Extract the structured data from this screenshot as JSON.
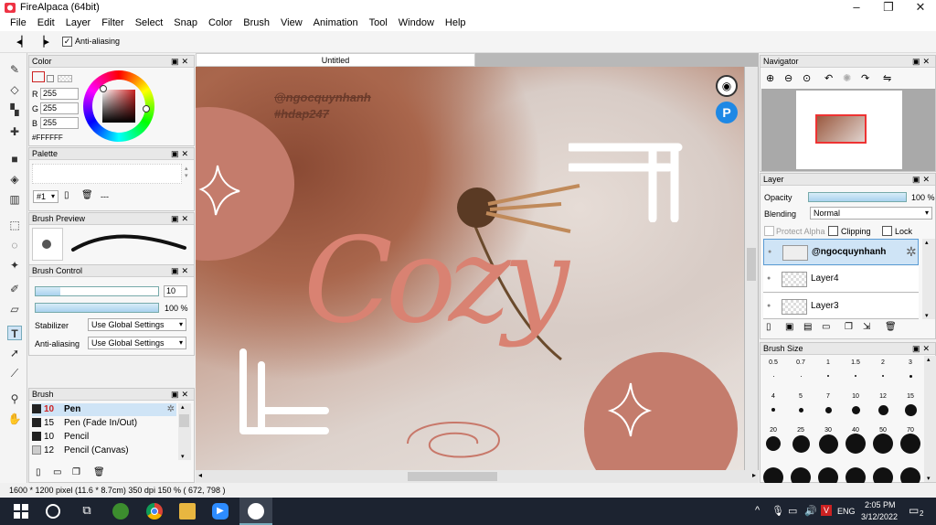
{
  "window": {
    "title": "FireAlpaca (64bit)",
    "minimize": "–",
    "maximize": "❐",
    "close": "✕"
  },
  "menu": [
    "File",
    "Edit",
    "Layer",
    "Filter",
    "Select",
    "Snap",
    "Color",
    "Brush",
    "View",
    "Animation",
    "Tool",
    "Window",
    "Help"
  ],
  "options": {
    "antialias_label": "Anti-aliasing"
  },
  "color_panel": {
    "title": "Color",
    "r_label": "R",
    "g_label": "G",
    "b_label": "B",
    "r": "255",
    "g": "255",
    "b": "255",
    "hex": "#FFFFFF"
  },
  "palette_panel": {
    "title": "Palette",
    "selector": "#1",
    "extra": "---"
  },
  "brush_preview_panel": {
    "title": "Brush Preview"
  },
  "brush_control": {
    "title": "Brush Control",
    "size": "10",
    "opacity": "100 %",
    "stabilizer_label": "Stabilizer",
    "stabilizer_value": "Use Global Settings",
    "antialias_label": "Anti-aliasing",
    "antialias_value": "Use Global Settings"
  },
  "brush_panel": {
    "title": "Brush",
    "items": [
      {
        "size": "10",
        "name": "Pen",
        "color": "#222222",
        "selected": true
      },
      {
        "size": "15",
        "name": "Pen (Fade In/Out)",
        "color": "#222222"
      },
      {
        "size": "10",
        "name": "Pencil",
        "color": "#222222"
      },
      {
        "size": "12",
        "name": "Pencil (Canvas)",
        "color": "#cccccc"
      }
    ]
  },
  "document": {
    "tab": "Untitled"
  },
  "artwork": {
    "watermark_1": "@ngocquynhanh",
    "watermark_2": "#hdap247",
    "word": "Cozy"
  },
  "navigator": {
    "title": "Navigator"
  },
  "layer_panel": {
    "title": "Layer",
    "opacity_label": "Opacity",
    "opacity_value": "100 %",
    "blending_label": "Blending",
    "blending_value": "Normal",
    "protect_alpha": "Protect Alpha",
    "clipping": "Clipping",
    "lock": "Lock",
    "layers": [
      {
        "name": "@ngocquynhanh",
        "selected": true
      },
      {
        "name": "Layer4"
      },
      {
        "name": "Layer3"
      }
    ]
  },
  "brush_size_panel": {
    "title": "Brush Size",
    "labels": [
      "0.5",
      "0.7",
      "1",
      "1.5",
      "2",
      "3",
      "4",
      "5",
      "7",
      "10",
      "12",
      "15",
      "20",
      "25",
      "30",
      "40",
      "50",
      "70"
    ]
  },
  "status": {
    "text": "1600 * 1200 pixel  (11.6 * 8.7cm)  350 dpi  150 %  ( 672, 798 )"
  },
  "taskbar": {
    "lang": "ENG",
    "time": "2:05 PM",
    "date": "3/12/2022",
    "notif": "2"
  }
}
